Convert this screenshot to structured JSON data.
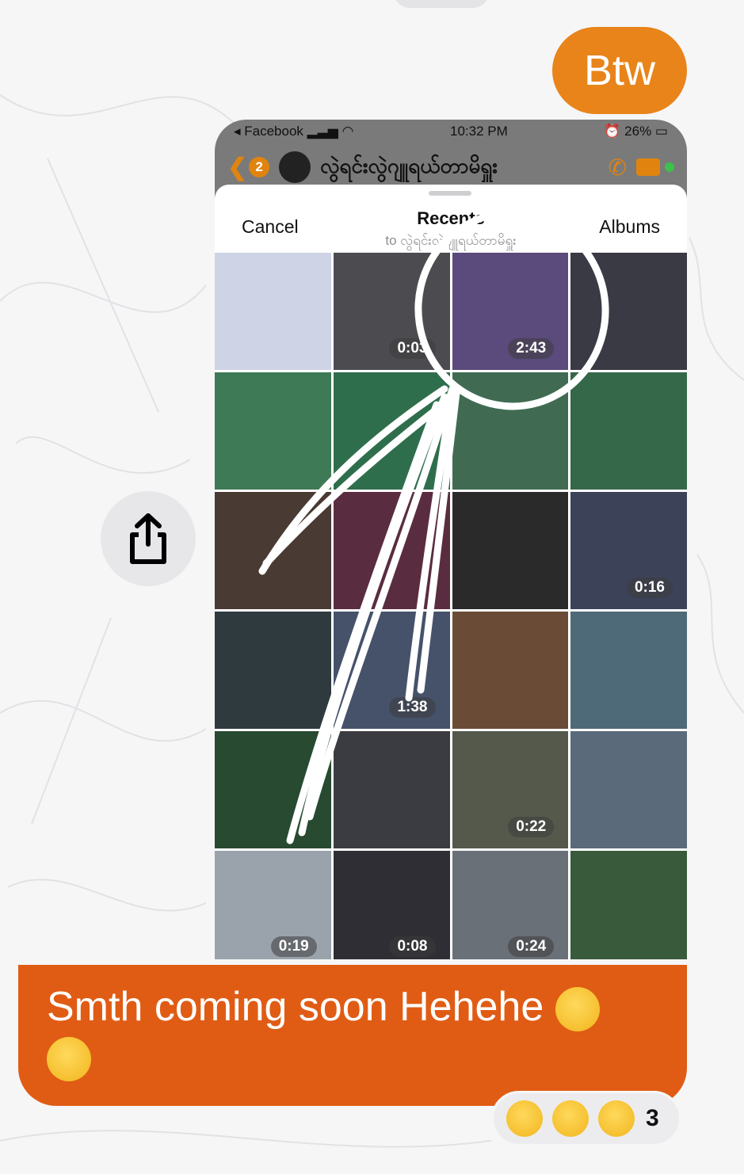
{
  "messages": {
    "btw": "Btw",
    "main": "Smth coming soon Hehehe"
  },
  "screenshot": {
    "status": {
      "carrier": "Facebook",
      "time": "10:32 PM",
      "battery": "26%"
    },
    "chat": {
      "back_count": "2",
      "title": "လွဲရင်းလွဲဂျူရယ်တာမိရှူး"
    },
    "picker": {
      "cancel": "Cancel",
      "title": "Recents",
      "subtitle": "to လွဲရင်းလွဲဂျူရယ်တာမိရှူး",
      "albums": "Albums"
    },
    "thumbnails": [
      {
        "dur": "",
        "bg": "#cfd3e6"
      },
      {
        "dur": "0:03",
        "bg": "#4c4c50"
      },
      {
        "dur": "2:43",
        "bg": "#5b4a7c"
      },
      {
        "dur": "",
        "bg": "#3a3a44"
      },
      {
        "dur": "",
        "bg": "#3e7a56"
      },
      {
        "dur": "",
        "bg": "#2f6e4c"
      },
      {
        "dur": "",
        "bg": "#406b52"
      },
      {
        "dur": "",
        "bg": "#356749"
      },
      {
        "dur": "",
        "bg": "#4a3a34"
      },
      {
        "dur": "",
        "bg": "#5a2c40"
      },
      {
        "dur": "",
        "bg": "#2a2a2a"
      },
      {
        "dur": "0:16",
        "bg": "#3c4258"
      },
      {
        "dur": "",
        "bg": "#2e3a3e"
      },
      {
        "dur": "1:38",
        "bg": "#45526a"
      },
      {
        "dur": "",
        "bg": "#6a4c36"
      },
      {
        "dur": "",
        "bg": "#4e6a78"
      },
      {
        "dur": "",
        "bg": "#274a30"
      },
      {
        "dur": "",
        "bg": "#3b3b42"
      },
      {
        "dur": "0:22",
        "bg": "#55594c"
      },
      {
        "dur": "",
        "bg": "#5a6a7a"
      },
      {
        "dur": "0:19",
        "bg": "#9aa3ab"
      },
      {
        "dur": "0:08",
        "bg": "#2e2e34"
      },
      {
        "dur": "0:24",
        "bg": "#6a7078"
      },
      {
        "dur": "",
        "bg": "#3a5a3c"
      }
    ]
  },
  "reactions": {
    "count": "3"
  },
  "colors": {
    "btw_bubble": "#e8841a",
    "main_bubble": "#e05c14"
  }
}
